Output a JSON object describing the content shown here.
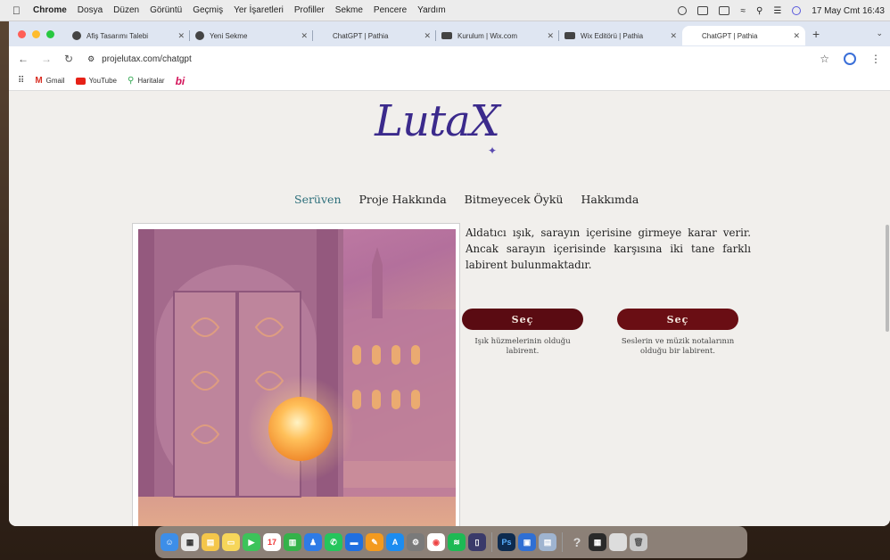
{
  "menubar": {
    "app_name": "Chrome",
    "items": [
      "Dosya",
      "Düzen",
      "Görüntü",
      "Geçmiş",
      "Yer İşaretleri",
      "Profiller",
      "Sekme",
      "Pencere",
      "Yardım"
    ],
    "datetime": "17 May Cmt 16:43"
  },
  "tabs": [
    {
      "label": "Afiş Tasarımı Talebi",
      "active": false
    },
    {
      "label": "Yeni Sekme",
      "active": false
    },
    {
      "label": "ChatGPT | Pathia",
      "active": false
    },
    {
      "label": "Kurulum | Wix.com",
      "active": false
    },
    {
      "label": "Wix Editörü | Pathia",
      "active": false
    },
    {
      "label": "ChatGPT | Pathia",
      "active": true
    }
  ],
  "address_bar": {
    "url": "projelutax.com/chatgpt"
  },
  "bookmarks": [
    {
      "label": "Gmail",
      "icon": "gmail-icon"
    },
    {
      "label": "YouTube",
      "icon": "youtube-icon"
    },
    {
      "label": "Haritalar",
      "icon": "maps-icon"
    },
    {
      "label": "bi",
      "icon": "bi-icon"
    }
  ],
  "site": {
    "logo": "LutaX",
    "nav": [
      {
        "label": "Serüven",
        "active": true
      },
      {
        "label": "Proje Hakkında",
        "active": false
      },
      {
        "label": "Bitmeyecek Öykü",
        "active": false
      },
      {
        "label": "Hakkımda",
        "active": false
      }
    ],
    "story_text": "Aldatıcı ışık, sarayın içerisine girmeye karar verir. Ancak sarayın içerisinde karşısına iki tane farklı labirent bulunmaktadır.",
    "choices": [
      {
        "button": "Seç",
        "caption": "Işık hüzmelerinin olduğu labirent."
      },
      {
        "button": "Seç",
        "caption": "Seslerin ve müzik notalarının olduğu bir labirent."
      }
    ]
  },
  "dock": {
    "calendar_day": "17"
  },
  "colors": {
    "accent": "#3b2a8c",
    "button": "#5a0b12",
    "nav_active": "#2c6e7a"
  }
}
